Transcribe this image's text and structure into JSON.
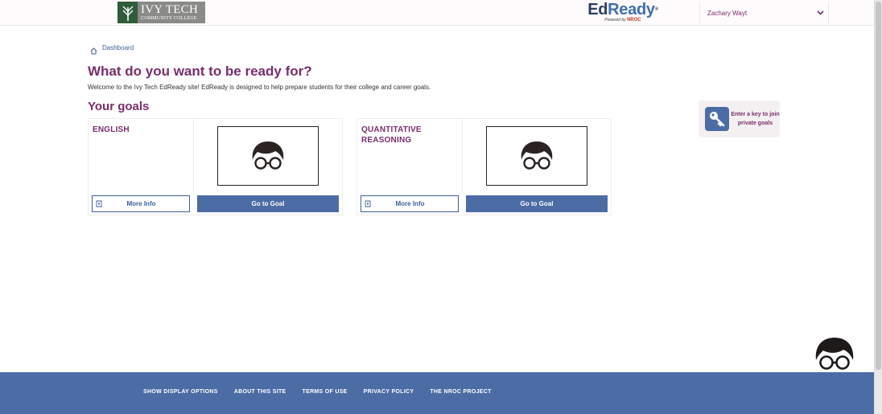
{
  "header": {
    "logo": {
      "line1": "IVY TECH",
      "line2": "COMMUNITY COLLEGE"
    },
    "edready": {
      "brand_ed": "Ed",
      "brand_ready": "Ready",
      "powered_by": "Powered by",
      "powered_org": "NROC"
    },
    "user": {
      "name": "Zachary Wayt"
    }
  },
  "breadcrumb": {
    "label": "Dashboard"
  },
  "main": {
    "title": "What do you want to be ready for?",
    "welcome": "Welcome to the Ivy Tech EdReady site! EdReady is designed to help prepare students for their college and career goals.",
    "goals_heading": "Your goals",
    "goals": [
      {
        "title": "ENGLISH",
        "more_info_label": "More Info",
        "go_label": "Go to Goal"
      },
      {
        "title": "QUANTITATIVE REASONING",
        "more_info_label": "More Info",
        "go_label": "Go to Goal"
      }
    ]
  },
  "join_key": {
    "label": "Enter a key to join private goals"
  },
  "footer": {
    "links": [
      "SHOW DISPLAY OPTIONS",
      "ABOUT THIS SITE",
      "TERMS OF USE",
      "PRIVACY POLICY",
      "THE NROC PROJECT"
    ]
  },
  "colors": {
    "brand_purple": "#7a2d6c",
    "brand_blue": "#4b6ca5",
    "link_blue": "#3e5f99"
  }
}
